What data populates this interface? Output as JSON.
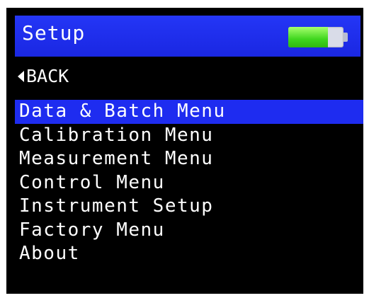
{
  "header": {
    "title": "Setup",
    "battery_level": 0.72,
    "battery_icon": "battery-icon",
    "accent_color": "#1e2cf0",
    "battery_color": "#3fd61e"
  },
  "back": {
    "label": "BACK",
    "icon": "triangle-left-icon"
  },
  "menu": {
    "selected_index": 0,
    "items": [
      {
        "label": "Data & Batch Menu"
      },
      {
        "label": "Calibration Menu"
      },
      {
        "label": "Measurement Menu"
      },
      {
        "label": "Control Menu"
      },
      {
        "label": "Instrument Setup"
      },
      {
        "label": "Factory Menu"
      },
      {
        "label": "About"
      }
    ]
  }
}
